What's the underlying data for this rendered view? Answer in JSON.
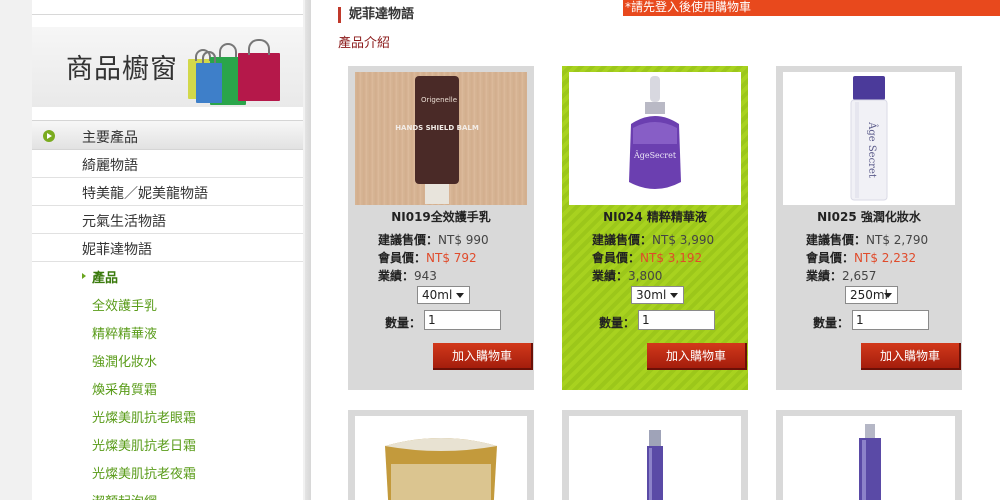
{
  "banner": {
    "title": "商品櫥窗"
  },
  "menu": {
    "heading": "主要產品",
    "categories": [
      "綺麗物語",
      "特美龍／妮美龍物語",
      "元氣生活物語",
      "妮菲達物語"
    ],
    "sub_heading": "產品",
    "sub_items": [
      "全效護手乳",
      "精粹精華液",
      "強潤化妝水",
      "煥采角質霜",
      "光燦美肌抗老眼霜",
      "光燦美肌抗老日霜",
      "光燦美肌抗老夜霜",
      "潔顏起泡網"
    ]
  },
  "header": {
    "breadcrumb": "妮菲達物語",
    "login_notice": "*請先登入後使用購物車",
    "intro_link": "產品介紹"
  },
  "labels": {
    "suggest_price": "建議售價：",
    "member_price": "會員價：",
    "performance": "業績：",
    "quantity": "數量：",
    "add_to_cart": "加入購物車"
  },
  "products": [
    {
      "name": "NI019全效護手乳",
      "price": "NT$ 990",
      "member_price": "NT$ 792",
      "performance": "943",
      "size": "40ml",
      "qty": "1",
      "tube_brand": "Origenelle",
      "tube_text": "HANDS SHIELD BALM"
    },
    {
      "name": "NI024 精粹精華液",
      "price": "NT$ 3,990",
      "member_price": "NT$ 3,192",
      "performance": "3,800",
      "size": "30ml",
      "qty": "1",
      "bottle_text": "ÂgeSecret"
    },
    {
      "name": "NI025 強潤化妝水",
      "price": "NT$ 2,790",
      "member_price": "NT$ 2,232",
      "performance": "2,657",
      "size": "250ml",
      "qty": "1",
      "bottle_text": "Âge Secret"
    }
  ],
  "colors": {
    "accent_red": "#d2391b",
    "active_green": "#a8d21f",
    "link_green": "#5a9c1a",
    "notice_orange": "#e8491d"
  }
}
